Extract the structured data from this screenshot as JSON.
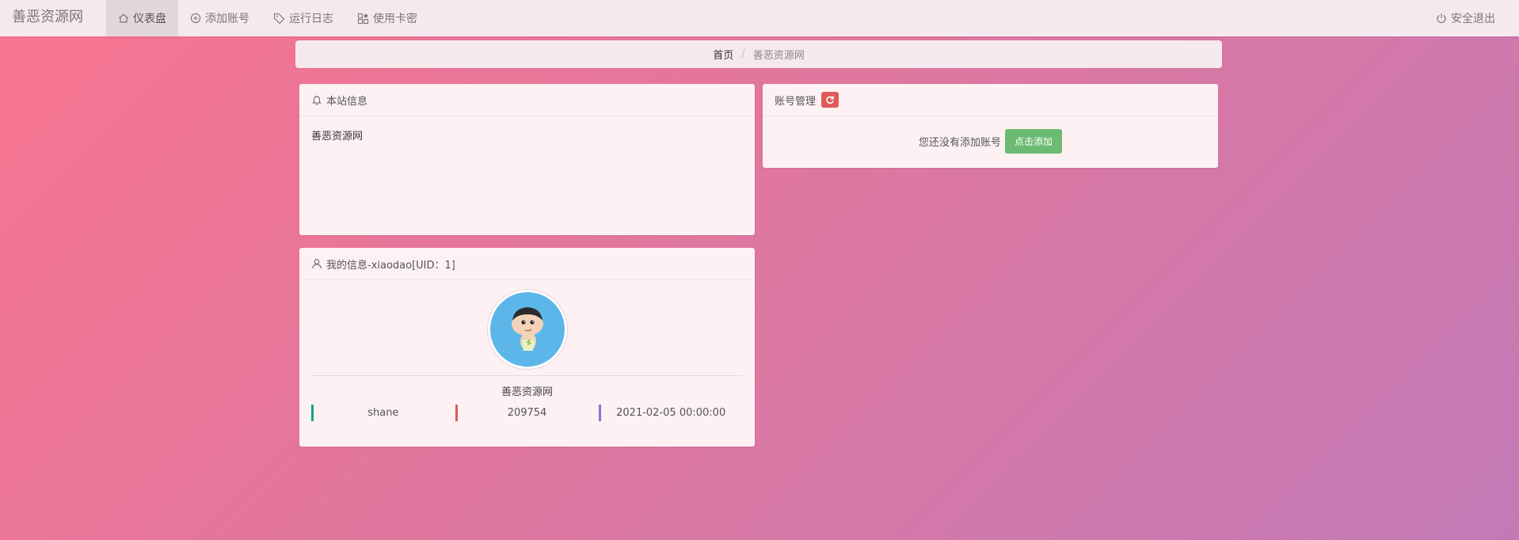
{
  "navbar": {
    "brand": "善恶资源网",
    "items": [
      {
        "label": "仪表盘",
        "icon": "home-icon",
        "active": true
      },
      {
        "label": "添加账号",
        "icon": "plus-circle-icon"
      },
      {
        "label": "运行日志",
        "icon": "tag-icon"
      },
      {
        "label": "使用卡密",
        "icon": "apps-icon"
      }
    ],
    "logout": {
      "label": "安全退出",
      "icon": "power-icon"
    }
  },
  "breadcrumb": {
    "home": "首页",
    "current": "善恶资源网"
  },
  "site_info": {
    "title": "本站信息",
    "icon": "bell-icon",
    "content": "善恶资源网"
  },
  "account": {
    "title": "账号管理",
    "empty_text": "您还没有添加账号",
    "add_button": "点击添加",
    "refresh_color": "#e05a5a"
  },
  "my_info": {
    "title": "我的信息-xiaodao[UID：1]",
    "icon": "user-icon",
    "nickname": "善恶资源网",
    "stats": [
      {
        "value": "shane",
        "color": "#16a085"
      },
      {
        "value": "209754",
        "color": "#e05a5a"
      },
      {
        "value": "2021-02-05 00:00:00",
        "color": "#8a74d6"
      }
    ]
  },
  "colors": {
    "accent_green": "#6bbb72",
    "navbar_bg": "#f6e9ee"
  }
}
